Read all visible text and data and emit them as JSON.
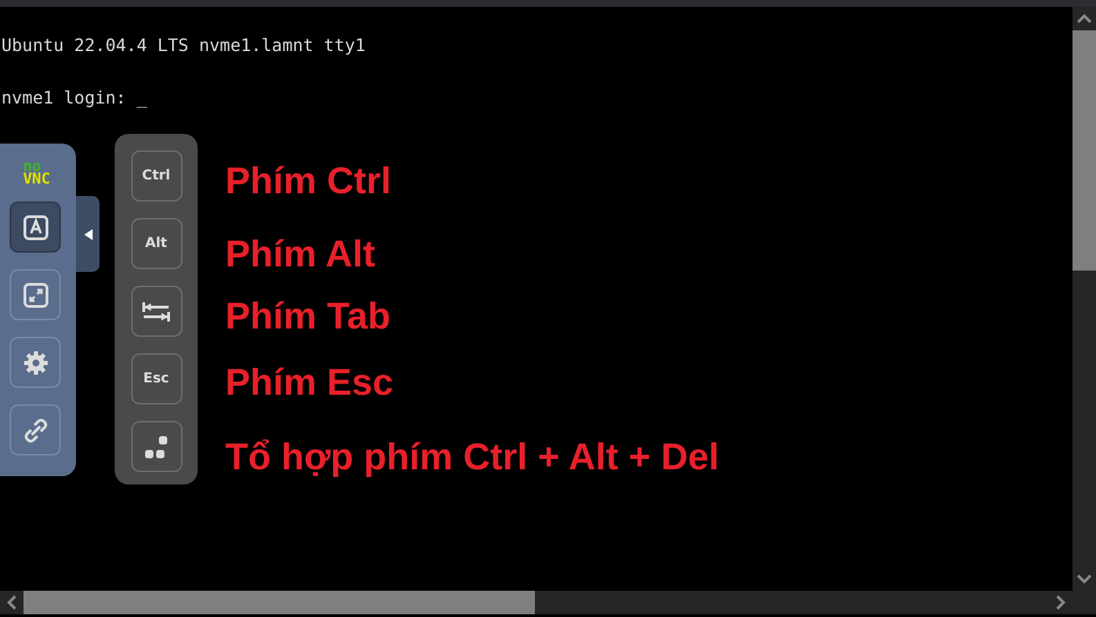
{
  "terminal": {
    "lines": [
      "Ubuntu 22.04.4 LTS nvme1.lamnt tty1",
      "nvme1 login: _"
    ]
  },
  "control_bar": {
    "logo": [
      "no",
      "VNC"
    ],
    "buttons": [
      {
        "kind": "keyboard",
        "selected": true
      },
      {
        "kind": "fullscreen",
        "selected": false
      },
      {
        "kind": "settings",
        "selected": false
      },
      {
        "kind": "disconnect",
        "selected": false
      }
    ]
  },
  "extra_keys": [
    {
      "kind": "text",
      "label": "Ctrl"
    },
    {
      "kind": "text",
      "label": "Alt"
    },
    {
      "kind": "tab"
    },
    {
      "kind": "text",
      "label": "Esc"
    },
    {
      "kind": "ctrlaltdel"
    }
  ],
  "annotations": [
    "Phím Ctrl",
    "Phím Alt",
    "Phím Tab",
    "Phím Esc",
    "Tổ hợp phím Ctrl + Alt + Del"
  ]
}
